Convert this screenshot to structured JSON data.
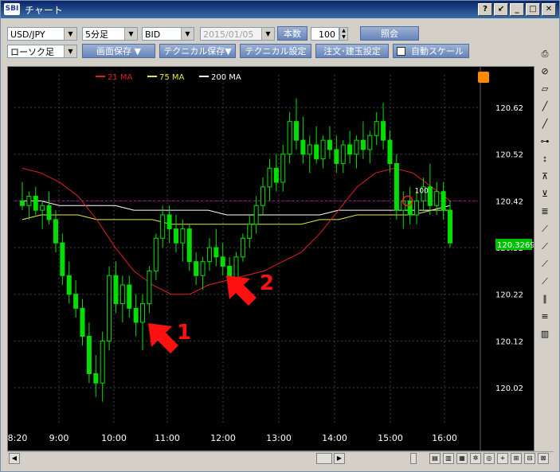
{
  "window": {
    "title": "チャート",
    "logo": "SBI",
    "buttons": [
      "?",
      "↙",
      "_",
      "□",
      "✕"
    ]
  },
  "toolbar1": {
    "pair": "USD/JPY",
    "interval": "5分足",
    "price_type": "BID",
    "date": "2015/01/05",
    "count_label": "本数",
    "count_value": "100",
    "query_button": "照会"
  },
  "toolbar2": {
    "chart_type": "ローソク足",
    "save_screen": "画面保存 ▼",
    "save_technical": "テクニカル保存▼",
    "technical_settings": "テクニカル設定",
    "order_settings": "注文･建玉設定",
    "auto_scale": "自動スケール"
  },
  "legend": [
    {
      "label": "21 MA",
      "color": "#e02020"
    },
    {
      "label": "75 MA",
      "color": "#e8e840"
    },
    {
      "label": "200 MA",
      "color": "#ffffff"
    }
  ],
  "chart_data": {
    "type": "line",
    "x_labels": [
      "8:20",
      "9:00",
      "10:00",
      "11:00",
      "12:00",
      "13:00",
      "14:00",
      "15:00",
      "16:00"
    ],
    "y_ticks": [
      "120.62",
      "120.52",
      "120.42",
      "120.32",
      "120.22",
      "120.12",
      "120.02"
    ],
    "ylim": [
      119.94,
      120.69
    ],
    "current_price": "120.3269",
    "current_price_color": "#00c000",
    "dashed_level": 120.42,
    "marker_label": "100",
    "candles": [
      {
        "t": 0.0,
        "o": 120.42,
        "h": 120.46,
        "l": 120.4,
        "c": 120.41
      },
      {
        "t": 1.0,
        "o": 120.41,
        "h": 120.44,
        "l": 120.38,
        "c": 120.43
      },
      {
        "t": 2.0,
        "o": 120.43,
        "h": 120.45,
        "l": 120.39,
        "c": 120.4
      },
      {
        "t": 3.0,
        "o": 120.4,
        "h": 120.42,
        "l": 120.36,
        "c": 120.41
      },
      {
        "t": 4.0,
        "o": 120.41,
        "h": 120.44,
        "l": 120.37,
        "c": 120.38
      },
      {
        "t": 5.0,
        "o": 120.38,
        "h": 120.4,
        "l": 120.31,
        "c": 120.33
      },
      {
        "t": 6.0,
        "o": 120.33,
        "h": 120.35,
        "l": 120.24,
        "c": 120.26
      },
      {
        "t": 7.0,
        "o": 120.26,
        "h": 120.29,
        "l": 120.2,
        "c": 120.22
      },
      {
        "t": 8.0,
        "o": 120.22,
        "h": 120.25,
        "l": 120.17,
        "c": 120.19
      },
      {
        "t": 9.0,
        "o": 120.19,
        "h": 120.21,
        "l": 120.11,
        "c": 120.13
      },
      {
        "t": 10.0,
        "o": 120.13,
        "h": 120.16,
        "l": 120.03,
        "c": 120.05
      },
      {
        "t": 11.0,
        "o": 120.05,
        "h": 120.09,
        "l": 120.0,
        "c": 120.03
      },
      {
        "t": 12.0,
        "o": 120.03,
        "h": 120.14,
        "l": 119.99,
        "c": 120.12
      },
      {
        "t": 13.0,
        "o": 120.12,
        "h": 120.28,
        "l": 120.1,
        "c": 120.26
      },
      {
        "t": 14.0,
        "o": 120.26,
        "h": 120.29,
        "l": 120.18,
        "c": 120.2
      },
      {
        "t": 15.0,
        "o": 120.2,
        "h": 120.26,
        "l": 120.16,
        "c": 120.24
      },
      {
        "t": 16.0,
        "o": 120.24,
        "h": 120.26,
        "l": 120.17,
        "c": 120.19
      },
      {
        "t": 17.0,
        "o": 120.19,
        "h": 120.22,
        "l": 120.13,
        "c": 120.16
      },
      {
        "t": 18.0,
        "o": 120.16,
        "h": 120.22,
        "l": 120.1,
        "c": 120.2
      },
      {
        "t": 19.0,
        "o": 120.2,
        "h": 120.28,
        "l": 120.18,
        "c": 120.27
      },
      {
        "t": 20.0,
        "o": 120.27,
        "h": 120.35,
        "l": 120.25,
        "c": 120.34
      },
      {
        "t": 21.0,
        "o": 120.34,
        "h": 120.41,
        "l": 120.32,
        "c": 120.39
      },
      {
        "t": 22.0,
        "o": 120.39,
        "h": 120.41,
        "l": 120.33,
        "c": 120.36
      },
      {
        "t": 23.0,
        "o": 120.36,
        "h": 120.39,
        "l": 120.31,
        "c": 120.33
      },
      {
        "t": 24.0,
        "o": 120.33,
        "h": 120.38,
        "l": 120.29,
        "c": 120.36
      },
      {
        "t": 25.0,
        "o": 120.36,
        "h": 120.37,
        "l": 120.27,
        "c": 120.29
      },
      {
        "t": 26.0,
        "o": 120.29,
        "h": 120.31,
        "l": 120.24,
        "c": 120.26
      },
      {
        "t": 27.0,
        "o": 120.26,
        "h": 120.3,
        "l": 120.23,
        "c": 120.29
      },
      {
        "t": 28.0,
        "o": 120.29,
        "h": 120.34,
        "l": 120.27,
        "c": 120.32
      },
      {
        "t": 29.0,
        "o": 120.32,
        "h": 120.36,
        "l": 120.28,
        "c": 120.3
      },
      {
        "t": 30.0,
        "o": 120.3,
        "h": 120.33,
        "l": 120.26,
        "c": 120.28
      },
      {
        "t": 31.0,
        "o": 120.28,
        "h": 120.3,
        "l": 120.23,
        "c": 120.25
      },
      {
        "t": 32.0,
        "o": 120.25,
        "h": 120.31,
        "l": 120.24,
        "c": 120.3
      },
      {
        "t": 33.0,
        "o": 120.3,
        "h": 120.35,
        "l": 120.29,
        "c": 120.34
      },
      {
        "t": 34.0,
        "o": 120.34,
        "h": 120.39,
        "l": 120.32,
        "c": 120.37
      },
      {
        "t": 35.0,
        "o": 120.37,
        "h": 120.43,
        "l": 120.35,
        "c": 120.41
      },
      {
        "t": 36.0,
        "o": 120.41,
        "h": 120.47,
        "l": 120.39,
        "c": 120.45
      },
      {
        "t": 37.0,
        "o": 120.45,
        "h": 120.51,
        "l": 120.42,
        "c": 120.49
      },
      {
        "t": 38.0,
        "o": 120.49,
        "h": 120.52,
        "l": 120.44,
        "c": 120.46
      },
      {
        "t": 39.0,
        "o": 120.46,
        "h": 120.54,
        "l": 120.44,
        "c": 120.52
      },
      {
        "t": 40.0,
        "o": 120.52,
        "h": 120.61,
        "l": 120.5,
        "c": 120.59
      },
      {
        "t": 41.0,
        "o": 120.59,
        "h": 120.64,
        "l": 120.53,
        "c": 120.55
      },
      {
        "t": 42.0,
        "o": 120.55,
        "h": 120.6,
        "l": 120.5,
        "c": 120.52
      },
      {
        "t": 43.0,
        "o": 120.52,
        "h": 120.56,
        "l": 120.48,
        "c": 120.54
      },
      {
        "t": 44.0,
        "o": 120.54,
        "h": 120.58,
        "l": 120.5,
        "c": 120.51
      },
      {
        "t": 45.0,
        "o": 120.51,
        "h": 120.56,
        "l": 120.49,
        "c": 120.55
      },
      {
        "t": 46.0,
        "o": 120.55,
        "h": 120.58,
        "l": 120.51,
        "c": 120.53
      },
      {
        "t": 47.0,
        "o": 120.53,
        "h": 120.56,
        "l": 120.48,
        "c": 120.5
      },
      {
        "t": 48.0,
        "o": 120.5,
        "h": 120.55,
        "l": 120.48,
        "c": 120.54
      },
      {
        "t": 49.0,
        "o": 120.54,
        "h": 120.57,
        "l": 120.5,
        "c": 120.52
      },
      {
        "t": 50.0,
        "o": 120.52,
        "h": 120.56,
        "l": 120.49,
        "c": 120.55
      },
      {
        "t": 51.0,
        "o": 120.55,
        "h": 120.59,
        "l": 120.51,
        "c": 120.53
      },
      {
        "t": 52.0,
        "o": 120.53,
        "h": 120.57,
        "l": 120.5,
        "c": 120.56
      },
      {
        "t": 53.0,
        "o": 120.56,
        "h": 120.61,
        "l": 120.54,
        "c": 120.59
      },
      {
        "t": 54.0,
        "o": 120.59,
        "h": 120.63,
        "l": 120.53,
        "c": 120.55
      },
      {
        "t": 55.0,
        "o": 120.55,
        "h": 120.57,
        "l": 120.48,
        "c": 120.5
      },
      {
        "t": 56.0,
        "o": 120.5,
        "h": 120.52,
        "l": 120.38,
        "c": 120.4
      },
      {
        "t": 57.0,
        "o": 120.4,
        "h": 120.44,
        "l": 120.36,
        "c": 120.42
      },
      {
        "t": 58.0,
        "o": 120.42,
        "h": 120.45,
        "l": 120.37,
        "c": 120.39
      },
      {
        "t": 59.0,
        "o": 120.39,
        "h": 120.44,
        "l": 120.37,
        "c": 120.42
      },
      {
        "t": 60.0,
        "o": 120.42,
        "h": 120.47,
        "l": 120.4,
        "c": 120.45
      },
      {
        "t": 61.0,
        "o": 120.45,
        "h": 120.5,
        "l": 120.39,
        "c": 120.41
      },
      {
        "t": 62.0,
        "o": 120.41,
        "h": 120.46,
        "l": 120.39,
        "c": 120.44
      },
      {
        "t": 63.0,
        "o": 120.44,
        "h": 120.46,
        "l": 120.38,
        "c": 120.4
      },
      {
        "t": 64.0,
        "o": 120.4,
        "h": 120.42,
        "l": 120.32,
        "c": 120.33
      }
    ],
    "ma21": [
      120.49,
      120.48,
      120.46,
      120.43,
      120.38,
      120.32,
      120.27,
      120.24,
      120.22,
      120.22,
      120.24,
      120.25,
      120.26,
      120.27,
      120.29,
      120.31,
      120.35,
      120.4,
      120.45,
      120.48,
      120.49,
      120.48,
      120.45,
      120.42
    ],
    "ma75": [
      120.38,
      120.39,
      120.39,
      120.39,
      120.38,
      120.38,
      120.38,
      120.38,
      120.37,
      120.37,
      120.37,
      120.37,
      120.37,
      120.37,
      120.37,
      120.37,
      120.38,
      120.38,
      120.39,
      120.39,
      120.39,
      120.39,
      120.4,
      120.4
    ],
    "ma200": [
      120.42,
      120.42,
      120.41,
      120.41,
      120.41,
      120.41,
      120.4,
      120.4,
      120.4,
      120.4,
      120.4,
      120.39,
      120.39,
      120.39,
      120.39,
      120.39,
      120.39,
      120.4,
      120.4,
      120.4,
      120.4,
      120.4,
      120.4,
      120.41
    ],
    "annotations": [
      "1",
      "2"
    ]
  },
  "right_tools": [
    "print-icon",
    "no-icon",
    "eraser-icon",
    "trend-line-icon",
    "line-icon",
    "horizontal-line-icon",
    "vertical-line-icon",
    "fibonacci-fan-icon",
    "fibonacci-retracement-icon",
    "fibonacci-channel-icon",
    "gann-fan-icon",
    "gann-grid-icon",
    "speed-line-icon",
    "parallel-line-icon",
    "channel-icon",
    "horizontal-channel-icon",
    "bars-icon"
  ]
}
